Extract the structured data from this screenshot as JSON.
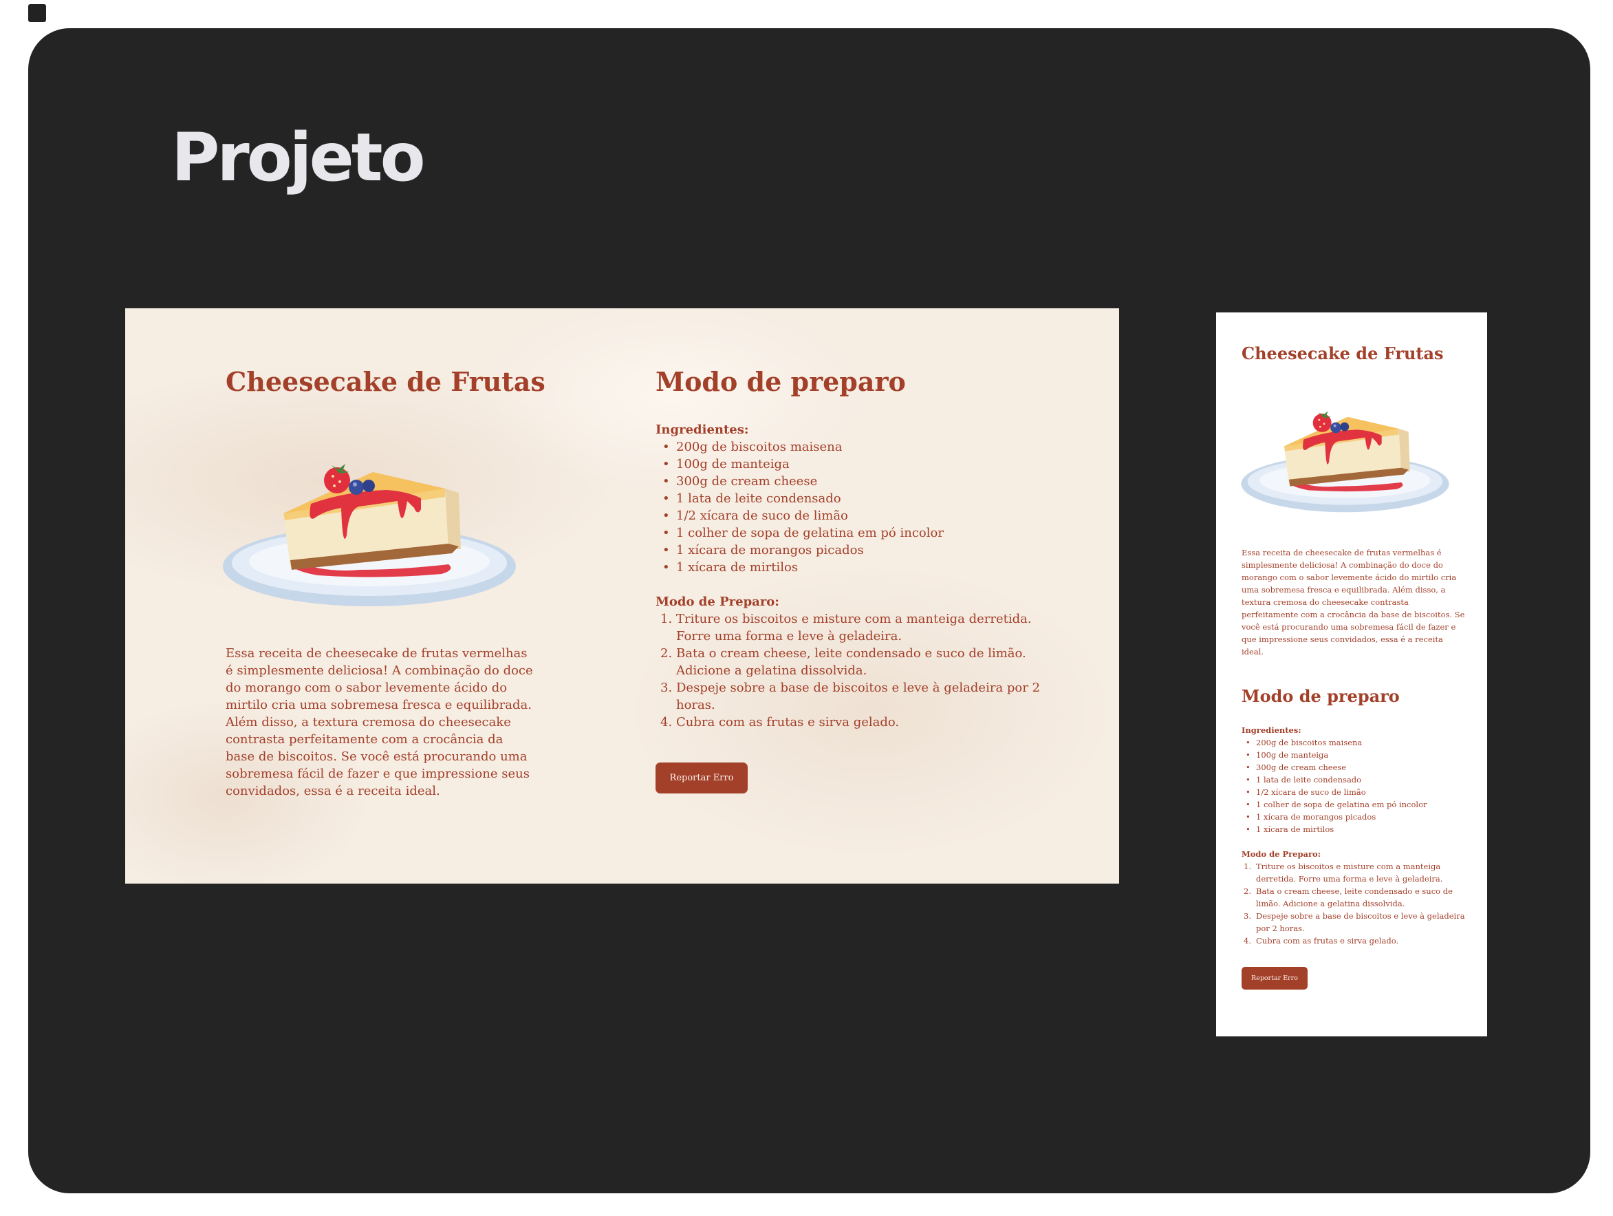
{
  "frame": {
    "title": "Projeto"
  },
  "recipe": {
    "title": "Cheesecake de Frutas",
    "description": "Essa receita de cheesecake de frutas vermelhas é simplesmente deliciosa! A combinação do doce do morango com o sabor levemente ácido do mirtilo cria uma sobremesa fresca e equilibrada. Além disso, a textura cremosa do cheesecake contrasta perfeitamente com a crocância da base de biscoitos. Se você está procurando uma sobremesa fácil de fazer e que impressione seus convidados, essa é a receita ideal.",
    "section_title": "Modo de preparo",
    "ingredients_label": "Ingredientes:",
    "ingredients": [
      "200g de biscoitos maisena",
      "100g de manteiga",
      "300g de cream cheese",
      "1 lata de leite condensado",
      "1/2 xícara de suco de limão",
      "1 colher de sopa de gelatina em pó incolor",
      "1 xícara de morangos picados",
      "1 xícara de mirtilos"
    ],
    "steps_label": "Modo de Preparo:",
    "steps": [
      "Triture os biscoitos e misture com a manteiga derretida. Forre uma forma e leve à geladeira.",
      "Bata o cream cheese, leite condensado e suco de limão. Adicione a gelatina dissolvida.",
      "Despeje sobre a base de biscoitos e leve à geladeira por 2 horas.",
      "Cubra com as frutas e sirva gelado."
    ],
    "button_label": "Reportar Erro"
  },
  "colors": {
    "accent": "#a3402a",
    "canvas": "#242424",
    "paper": "#f6ede3",
    "title_text": "#e7e7ec"
  },
  "icons": {
    "cake_illustration": "cheesecake-slice-image"
  }
}
